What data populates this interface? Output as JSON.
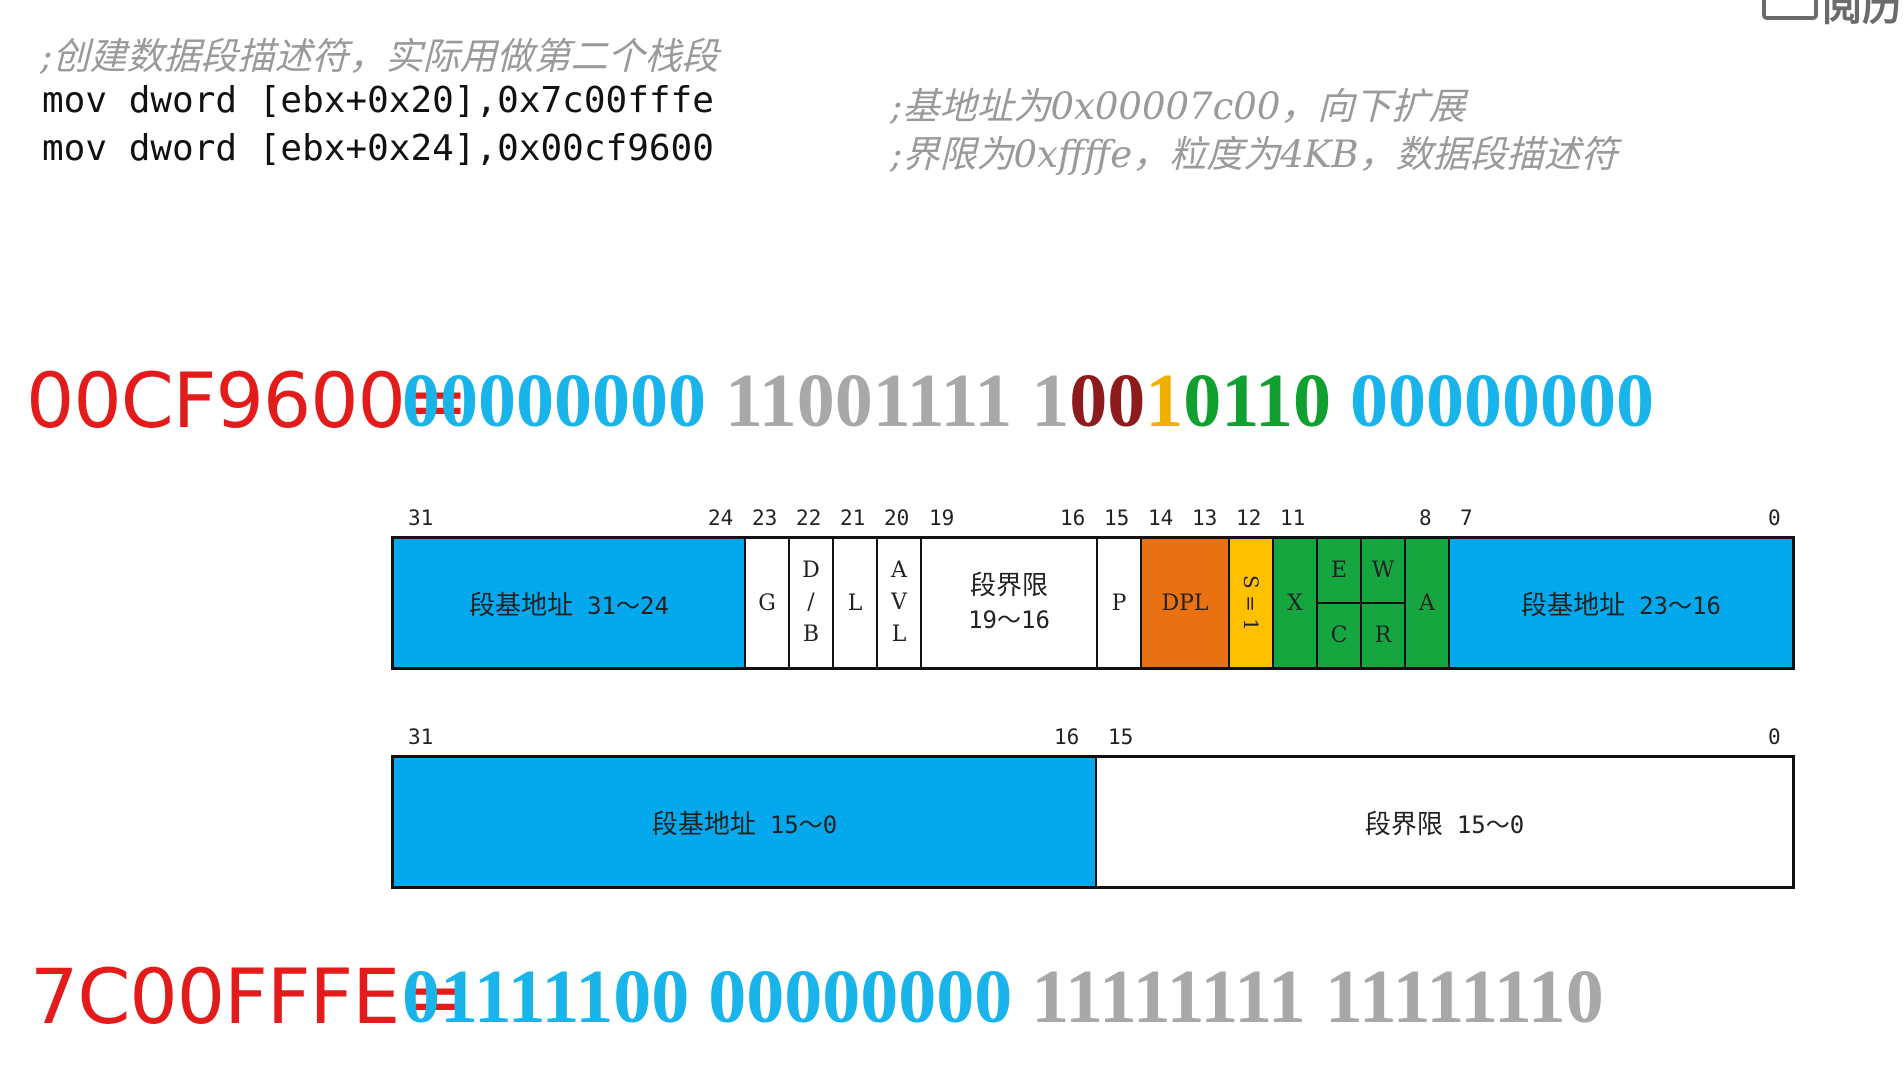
{
  "header": {
    "corner_text": "阅历"
  },
  "code": {
    "comment_line": ";创建数据段描述符，实际用做第二个栈段",
    "line1": "mov dword [ebx+0x20],0x7c00fffe",
    "line1_comment": ";基地址为0x00007c00，向下扩展",
    "line2": "mov dword [ebx+0x24],0x00cf9600",
    "line2_comment": ";界限为0xffffe，粒度为4KB，数据段描述符"
  },
  "high_value": {
    "label": "00CF9600=",
    "bits": {
      "byte1": "00000000",
      "byte2": "11001111",
      "byte3_a": "100",
      "byte3_b": "1",
      "byte3_c": "0110",
      "byte4": "00000000"
    }
  },
  "high_descriptor": {
    "bit_numbers": [
      "31",
      "24",
      "23",
      "22",
      "21",
      "20",
      "19",
      "16",
      "15",
      "14",
      "13",
      "12",
      "11",
      "8",
      "7",
      "0"
    ],
    "fields": {
      "base_31_24_name": "段基地址",
      "base_31_24_range": "31～24",
      "g": "G",
      "db_d": "D",
      "db_slash": "/",
      "db_b": "B",
      "l": "L",
      "avl_a": "A",
      "avl_v": "V",
      "avl_l": "L",
      "limit_19_16_name": "段界限",
      "limit_19_16_range": "19～16",
      "p": "P",
      "dpl": "DPL",
      "s": "S = 1",
      "x": "X",
      "e": "E",
      "c": "C",
      "w": "W",
      "r": "R",
      "a": "A",
      "base_23_16_name": "段基地址",
      "base_23_16_range": "23～16"
    }
  },
  "low_descriptor": {
    "bit_numbers": [
      "31",
      "16",
      "15",
      "0"
    ],
    "fields": {
      "base_15_0_name": "段基地址",
      "base_15_0_range": "15～0",
      "limit_15_0_name": "段界限",
      "limit_15_0_range": "15～0"
    }
  },
  "low_value": {
    "label": "7C00FFFE=",
    "bits": {
      "byte1": "01111100",
      "byte2": "00000000",
      "byte3": "11111111",
      "byte4": "11111110"
    }
  },
  "colors": {
    "base": "#03a9ec",
    "dpl": "#ea7111",
    "s": "#ffc000",
    "type": "#15a640",
    "hex_label": "#e31b1b"
  }
}
